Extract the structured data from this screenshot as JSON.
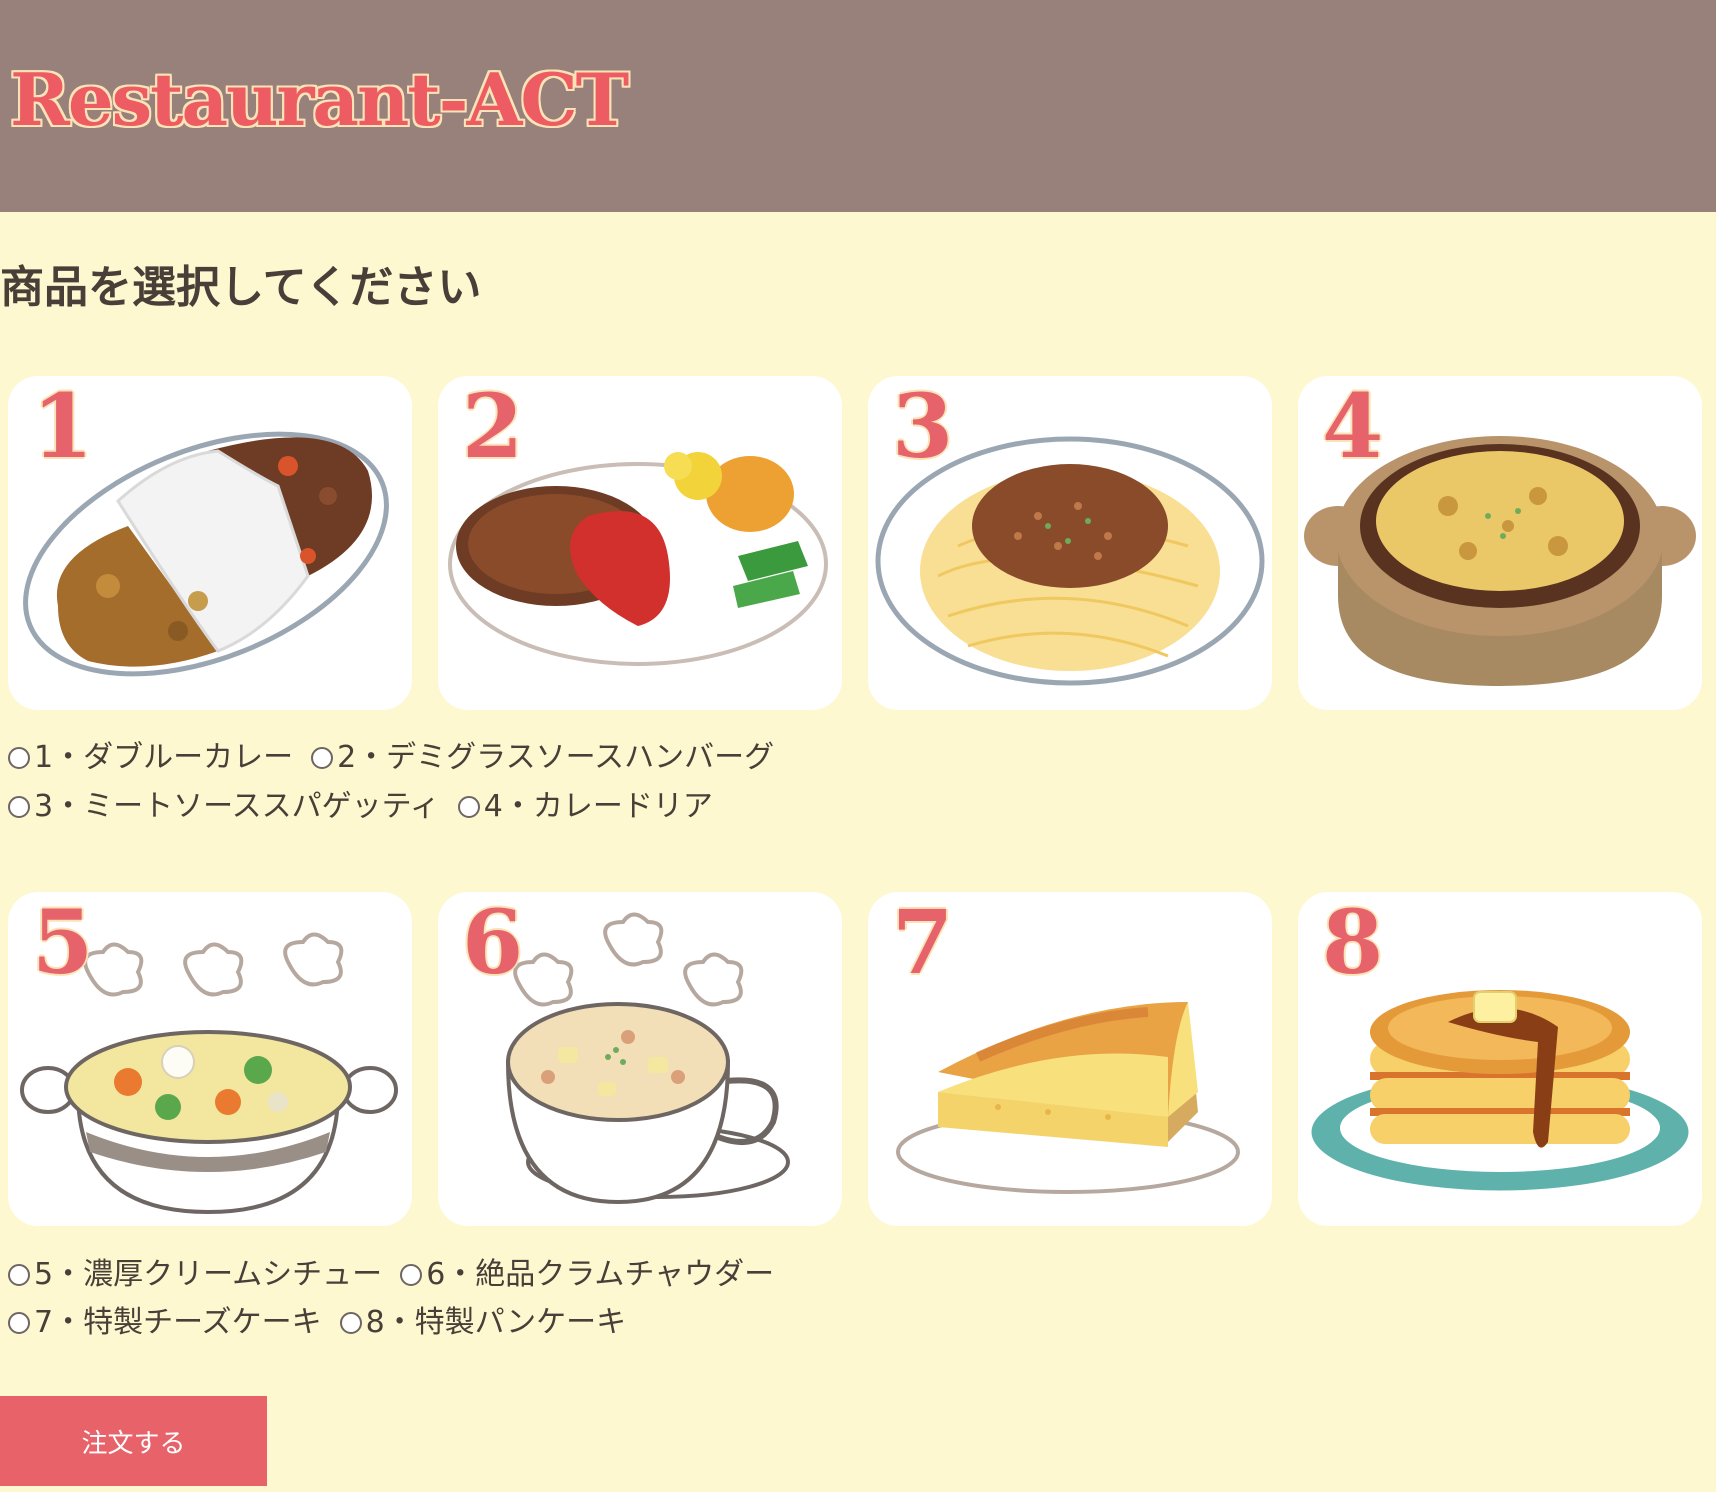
{
  "header": {
    "title": "Restaurant-ACT"
  },
  "page": {
    "heading": "商品を選択してください"
  },
  "menu": {
    "items": [
      {
        "number": "1",
        "label": "1・ダブルーカレー"
      },
      {
        "number": "2",
        "label": "2・デミグラスソースハンバーグ"
      },
      {
        "number": "3",
        "label": "3・ミートソーススパゲッティ"
      },
      {
        "number": "4",
        "label": "4・カレードリア"
      },
      {
        "number": "5",
        "label": "5・濃厚クリームシチュー"
      },
      {
        "number": "6",
        "label": "6・絶品クラムチャウダー"
      },
      {
        "number": "7",
        "label": "7・特製チーズケーキ"
      },
      {
        "number": "8",
        "label": "8・特製パンケーキ"
      }
    ]
  },
  "order_button": {
    "label": "注文する"
  },
  "colors": {
    "header_bg": "#98807b",
    "page_bg": "#fdf8d0",
    "accent": "#e8626a"
  },
  "icons": [
    "curry-rice-icon",
    "hamburg-steak-icon",
    "meat-sauce-spaghetti-icon",
    "curry-doria-icon",
    "cream-stew-icon",
    "clam-chowder-icon",
    "cheesecake-icon",
    "pancake-icon"
  ]
}
